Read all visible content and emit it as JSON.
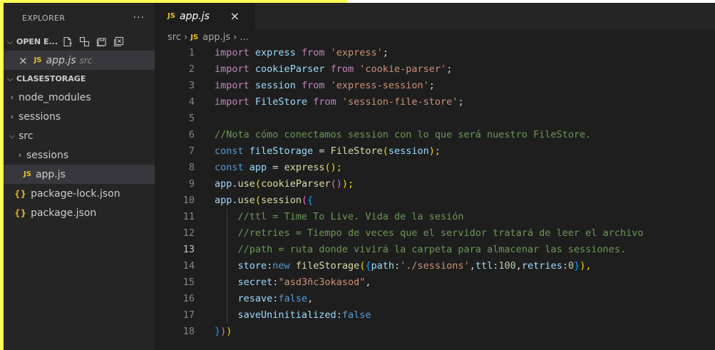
{
  "sidebar": {
    "title": "EXPLORER",
    "more": "···",
    "open_editors": {
      "label": "OPEN E...",
      "items": [
        {
          "badge": "JS",
          "name": "app.js",
          "path": "src"
        }
      ]
    },
    "project": {
      "label": "CLASESTORAGE",
      "items": [
        {
          "label": "node_modules",
          "type": "folder"
        },
        {
          "label": "sessions",
          "type": "folder"
        },
        {
          "label": "src",
          "type": "folder-open"
        },
        {
          "label": "sessions",
          "type": "folder"
        },
        {
          "label": "app.js",
          "type": "js"
        },
        {
          "label": "package-lock.json",
          "type": "json"
        },
        {
          "label": "package.json",
          "type": "json"
        }
      ]
    }
  },
  "editor": {
    "tab": {
      "badge": "JS",
      "name": "app.js",
      "close": "×"
    },
    "breadcrumb": {
      "folder": "src",
      "badge": "JS",
      "file": "app.js",
      "rest": "..."
    },
    "current_line": 13,
    "lines": [
      {
        "n": "1",
        "t": [
          "import",
          " ",
          "express",
          " ",
          "from",
          " ",
          "'express'",
          ";"
        ]
      },
      {
        "n": "2",
        "t": [
          "import",
          " ",
          "cookieParser",
          " ",
          "from",
          " ",
          "'cookie-parser'",
          ";"
        ]
      },
      {
        "n": "3",
        "t": [
          "import",
          " ",
          "session",
          " ",
          "from",
          " ",
          "'express-session'",
          ";"
        ]
      },
      {
        "n": "4",
        "t": [
          "import",
          " ",
          "FileStore",
          " ",
          "from",
          " ",
          "'session-file-store'",
          ";"
        ]
      },
      {
        "n": "5",
        "t": []
      },
      {
        "n": "6",
        "t": [
          "//Nota cómo conectamos session con lo que será nuestro FileStore."
        ]
      },
      {
        "n": "7",
        "t": [
          "const",
          " ",
          "fileStorage",
          " = ",
          "FileStore",
          "(",
          "session",
          ");"
        ]
      },
      {
        "n": "8",
        "t": [
          "const",
          " ",
          "app",
          " = ",
          "express",
          "();"
        ]
      },
      {
        "n": "9",
        "t": [
          "app",
          ".",
          "use",
          "(",
          "cookieParser",
          "()",
          ");"
        ]
      },
      {
        "n": "10",
        "t": [
          "app",
          ".",
          "use",
          "(",
          "session",
          "(",
          "{"
        ]
      },
      {
        "n": "11",
        "t": [
          "    ",
          "//ttl = Time To Live. Vida de la sesión"
        ]
      },
      {
        "n": "12",
        "t": [
          "    ",
          "//retries = Tiempo de veces que el servidor tratará de leer el archivo"
        ]
      },
      {
        "n": "13",
        "t": [
          "    ",
          "//path = ruta donde vivirá la carpeta para almacenar las sessiones."
        ]
      },
      {
        "n": "14",
        "t": [
          "    ",
          "store",
          ":",
          "new",
          " ",
          "fileStorage",
          "(",
          "{",
          "path",
          ":",
          "'./sessions'",
          ",",
          "ttl",
          ":",
          "100",
          ",",
          "retries",
          ":",
          "0",
          "}",
          "),"
        ]
      },
      {
        "n": "15",
        "t": [
          "    ",
          "secret",
          ":",
          "\"asd3ñc3okasod\"",
          ","
        ]
      },
      {
        "n": "16",
        "t": [
          "    ",
          "resave",
          ":",
          "false",
          ","
        ]
      },
      {
        "n": "17",
        "t": [
          "    ",
          "saveUninitialized",
          ":",
          "false"
        ]
      },
      {
        "n": "18",
        "t": [
          "}",
          ")",
          ")"
        ]
      }
    ],
    "classes": [
      [
        "m",
        "p",
        "v",
        "p",
        "m",
        "p",
        "s",
        "p"
      ],
      [
        "m",
        "p",
        "v",
        "p",
        "m",
        "p",
        "s",
        "p"
      ],
      [
        "m",
        "p",
        "v",
        "p",
        "m",
        "p",
        "s",
        "p"
      ],
      [
        "m",
        "p",
        "v",
        "p",
        "m",
        "p",
        "s",
        "p"
      ],
      [],
      [
        "c"
      ],
      [
        "k",
        "p",
        "v",
        "p",
        "f",
        "y",
        "v",
        "y"
      ],
      [
        "k",
        "p",
        "v",
        "p",
        "f",
        "y"
      ],
      [
        "v",
        "p",
        "f",
        "y",
        "f",
        "pk",
        "y"
      ],
      [
        "v",
        "p",
        "f",
        "y",
        "f",
        "pk",
        "bl"
      ],
      [
        "g",
        "c"
      ],
      [
        "g",
        "c"
      ],
      [
        "g",
        "c"
      ],
      [
        "g",
        "v",
        "p",
        "k",
        "p",
        "f",
        "y",
        "bl",
        "v",
        "p",
        "s",
        "p",
        "v",
        "p",
        "n",
        "p",
        "v",
        "p",
        "n",
        "bl",
        "y"
      ],
      [
        "g",
        "v",
        "p",
        "s",
        "p"
      ],
      [
        "g",
        "v",
        "p",
        "k",
        "p"
      ],
      [
        "g",
        "v",
        "p",
        "k"
      ],
      [
        "bl",
        "pk",
        "y"
      ]
    ]
  }
}
